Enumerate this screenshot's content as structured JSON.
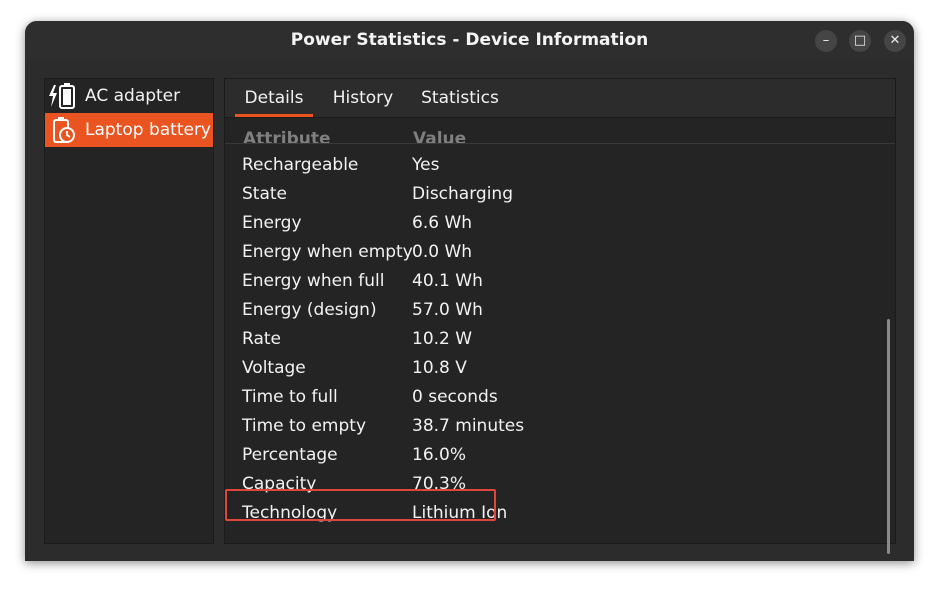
{
  "window": {
    "title": "Power Statistics - Device Information",
    "controls": {
      "minimize": "–",
      "maximize": "□",
      "close": "✕"
    }
  },
  "sidebar": {
    "items": [
      {
        "label": "AC adapter",
        "icon": "ac-adapter-icon",
        "selected": false
      },
      {
        "label": "Laptop battery",
        "icon": "battery-clock-icon",
        "selected": true
      }
    ]
  },
  "tabs": [
    {
      "label": "Details",
      "active": true
    },
    {
      "label": "History",
      "active": false
    },
    {
      "label": "Statistics",
      "active": false
    }
  ],
  "details": {
    "header": {
      "attribute": "Attribute",
      "value": "Value"
    },
    "rows": [
      {
        "attribute": "Rechargeable",
        "value": "Yes"
      },
      {
        "attribute": "State",
        "value": "Discharging"
      },
      {
        "attribute": "Energy",
        "value": "6.6 Wh"
      },
      {
        "attribute": "Energy when empty",
        "value": "0.0 Wh"
      },
      {
        "attribute": "Energy when full",
        "value": "40.1 Wh"
      },
      {
        "attribute": "Energy (design)",
        "value": "57.0 Wh"
      },
      {
        "attribute": "Rate",
        "value": "10.2 W"
      },
      {
        "attribute": "Voltage",
        "value": "10.8 V"
      },
      {
        "attribute": "Time to full",
        "value": "0 seconds"
      },
      {
        "attribute": "Time to empty",
        "value": "38.7 minutes"
      },
      {
        "attribute": "Percentage",
        "value": "16.0%"
      },
      {
        "attribute": "Capacity",
        "value": "70.3%",
        "highlighted": true
      },
      {
        "attribute": "Technology",
        "value": "Lithium Ion"
      }
    ]
  },
  "colors": {
    "accent": "#e95420",
    "highlight_box": "#e0473c"
  }
}
